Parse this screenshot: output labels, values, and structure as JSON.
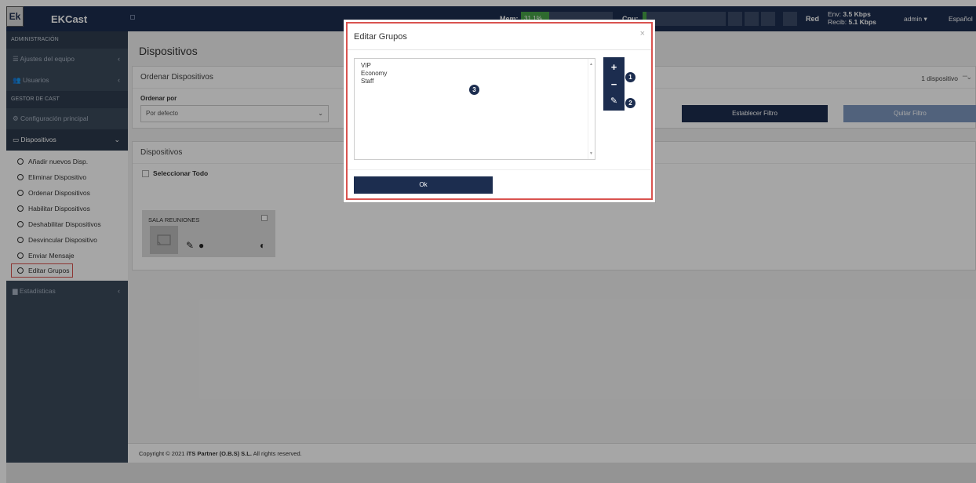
{
  "topbar": {
    "logo": "Ek",
    "app_title": "EKCast",
    "mem_label": "Mem:",
    "mem_value": "31.1%",
    "mem_fraction": 0.311,
    "cpu_label": "Cpu:",
    "cpu_fraction": 0.05,
    "net_label": "Red",
    "env_label": "Env:",
    "env_value": "3.5 Kbps",
    "recib_label": "Recib:",
    "recib_value": "5.1 Kbps",
    "user": "admin",
    "language": "Español"
  },
  "sidebar": {
    "section_admin": "ADMINISTRACIÓN",
    "item_ajustes": "Ajustes del equipo",
    "item_usuarios": "Usuarios",
    "section_gestor": "GESTOR DE CAST",
    "item_config": "Configuración principal",
    "item_dispositivos": "Dispositivos",
    "sub": [
      "Añadir nuevos Disp.",
      "Eliminar Dispositivo",
      "Ordenar Dispositivos",
      "Habilitar Dispositivos",
      "Deshabilitar Dispositivos",
      "Desvincular Dispositivo",
      "Enviar Mensaje",
      "Editar Grupos"
    ],
    "item_estadisticas": "Estadísticas"
  },
  "main": {
    "page_title": "Dispositivos",
    "order_panel_title": "Ordenar Dispositivos",
    "order_by_label": "Ordenar por",
    "order_by_value": "Por defecto",
    "device_count": "1 dispositivo",
    "btn_set_filter": "Establecer Filtro",
    "btn_remove_filter": "Quitar Filtro",
    "devices_panel_title": "Dispositivos",
    "select_all": "Seleccionar Todo",
    "device_name": "SALA REUNIONES",
    "footer_prefix": "Copyright © 2021 ",
    "footer_company": "iTS Partner (O.B.S) S.L.",
    "footer_suffix": " All rights reserved."
  },
  "modal": {
    "title": "Editar Grupos",
    "close": "×",
    "groups": [
      "VIP",
      "Economy",
      "Staff"
    ],
    "add_symbol": "+",
    "remove_symbol": "−",
    "edit_symbol": "✎",
    "callout_1": "1",
    "callout_2": "2",
    "callout_3": "3",
    "ok_label": "Ok"
  },
  "colors": {
    "navy": "#1c2d4f",
    "sidebar": "#3b4a5b",
    "highlight": "#d9534f",
    "mem_green": "#47a447"
  }
}
